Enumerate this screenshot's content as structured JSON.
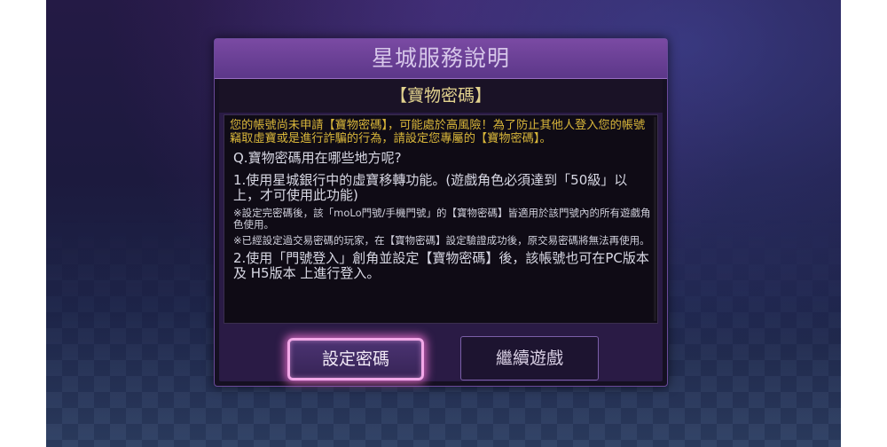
{
  "dialog": {
    "title": "星城服務說明",
    "subtitle": "【寶物密碼】",
    "warning": "您的帳號尚未申請【寶物密碼】，可能處於高風險！為了防止其他人登入您的帳號竊取虛寶或是進行詐騙的行為，請設定您專屬的【寶物密碼】。",
    "question": "Q.寶物密碼用在哪些地方呢?",
    "item1": "1.使用星城銀行中的虛寶移轉功能。(遊戲角色必須達到「50級」以上，才可使用此功能)",
    "note1": "※設定完密碼後，該「moLo門號/手機門號」的【寶物密碼】皆適用於該門號內的所有遊戲角色使用。",
    "note2": "※已經設定過交易密碼的玩家，在【寶物密碼】設定驗證成功後，原交易密碼將無法再使用。",
    "item2": "2.使用「門號登入」創角並設定【寶物密碼】後，該帳號也可在PC版本 及 H5版本 上進行登入。"
  },
  "buttons": {
    "set_password": "設定密碼",
    "continue_game": "繼續遊戲"
  },
  "colors": {
    "title_bar": "#6a3f96",
    "warning_text": "#d8b63a",
    "subtitle_text": "#e2d28e",
    "primary_glow": "#f2a8e8"
  }
}
